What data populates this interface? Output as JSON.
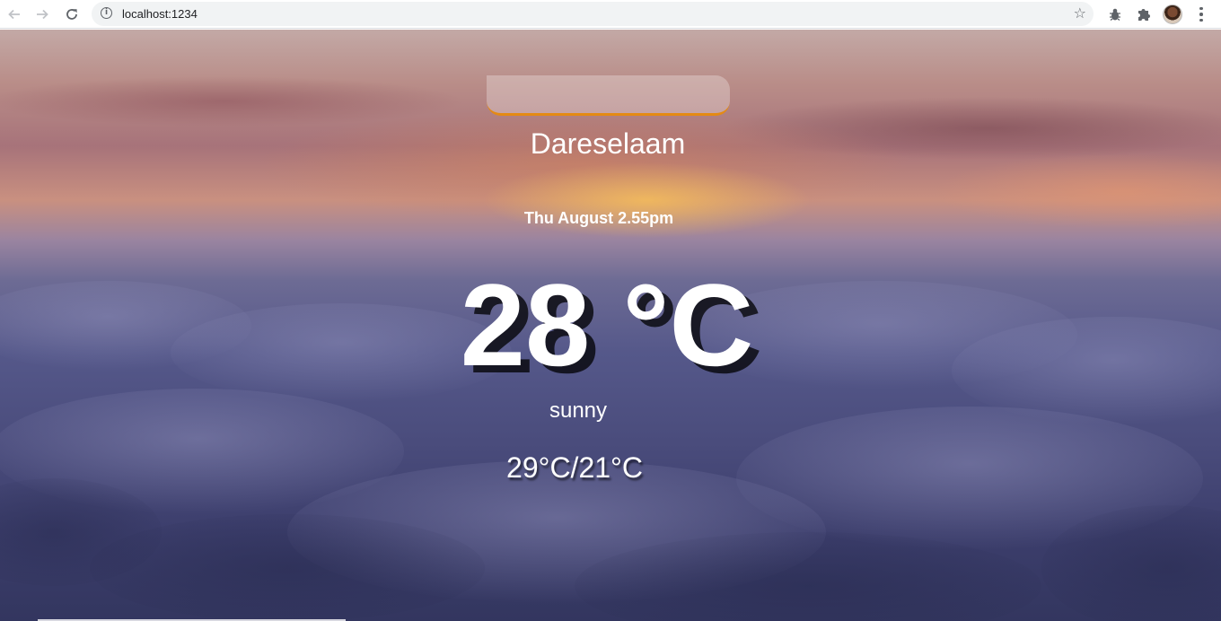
{
  "browser": {
    "url": "localhost:1234"
  },
  "search": {
    "value": "",
    "placeholder": ""
  },
  "weather": {
    "city": "Dareselaam",
    "date": "Thu August 2.55pm",
    "temperature": "28 °C",
    "condition": "sunny",
    "hi_low": "29°C/21°C"
  },
  "colors": {
    "search_underline": "#e48a14",
    "text": "#ffffff"
  },
  "icons": {
    "back": "arrow-left-icon",
    "forward": "arrow-right-icon",
    "reload": "reload-icon",
    "info": "info-icon",
    "bookmark": "star-icon",
    "extension_bug": "bug-icon",
    "extensions": "puzzle-icon",
    "profile": "avatar",
    "menu": "kebab-menu-icon"
  }
}
